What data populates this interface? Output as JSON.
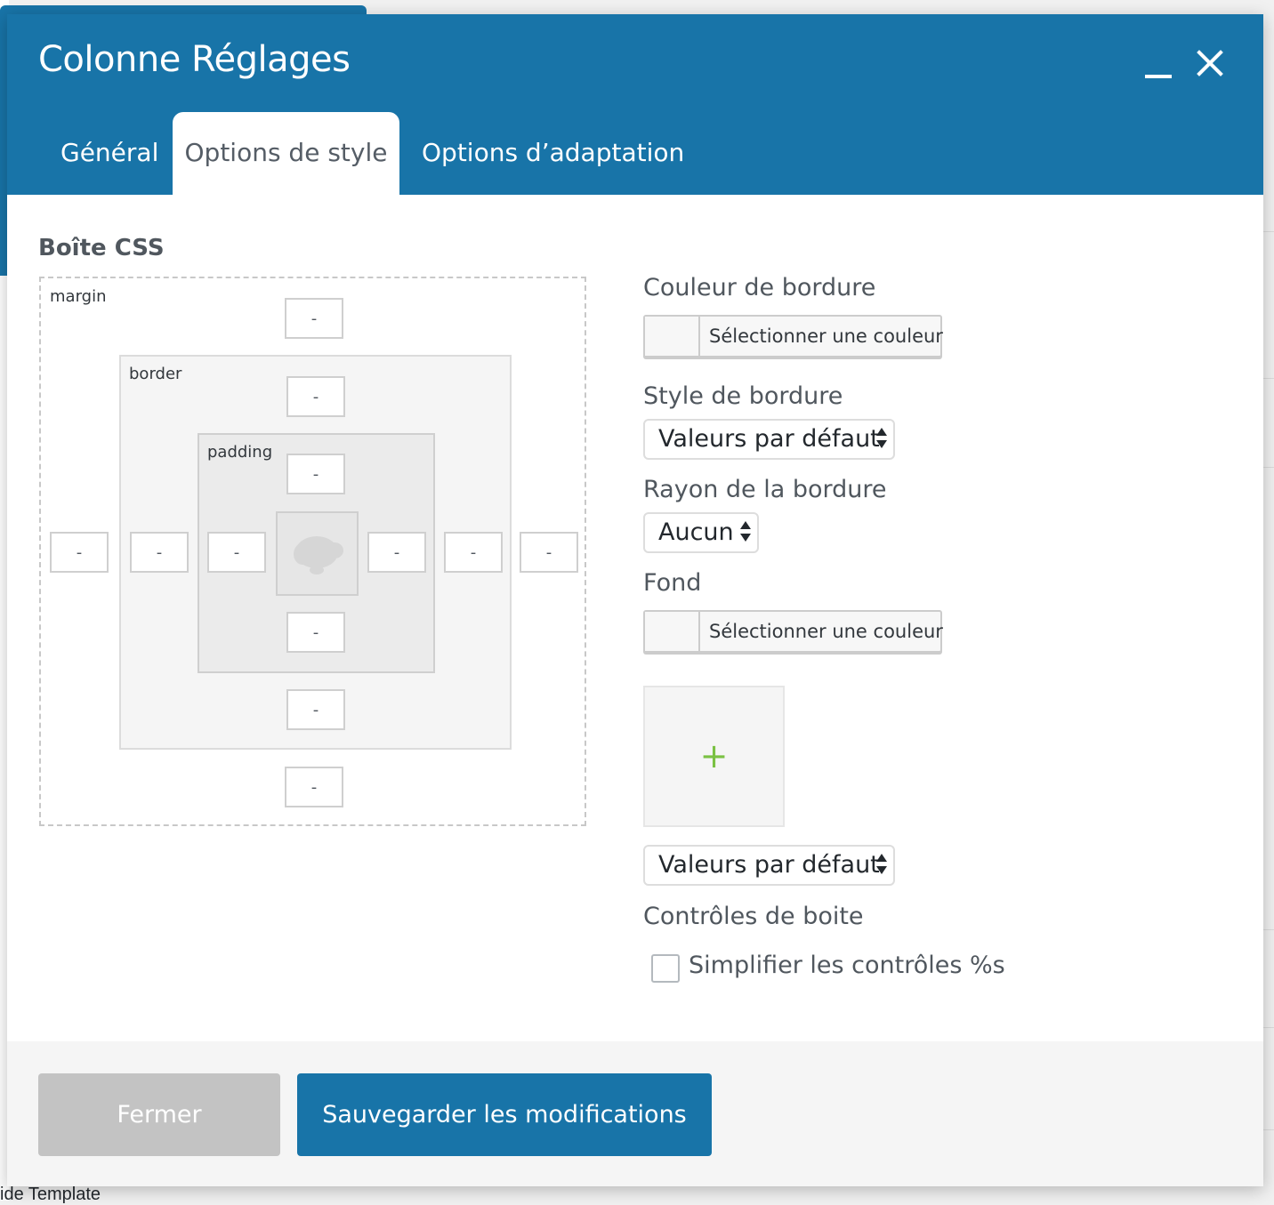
{
  "background": {
    "bottom_text": "ide Template"
  },
  "modal": {
    "title": "Colonne Réglages",
    "tabs": [
      {
        "label": "Général"
      },
      {
        "label": "Options de style"
      },
      {
        "label": "Options d’adaptation"
      }
    ],
    "active_tab": "Options de style"
  },
  "css_box": {
    "title": "Boîte CSS",
    "margin_label": "margin",
    "border_label": "border",
    "padding_label": "padding",
    "margin": {
      "top": "-",
      "right": "-",
      "bottom": "-",
      "left": "-"
    },
    "border": {
      "top": "-",
      "right": "-",
      "bottom": "-",
      "left": "-"
    },
    "padding": {
      "top": "-",
      "right": "-",
      "bottom": "-",
      "left": "-"
    },
    "content_icon": "content-placeholder-icon"
  },
  "fields": {
    "border_color_label": "Couleur de bordure",
    "border_color_button": "Sélectionner une couleur",
    "border_style_label": "Style de bordure",
    "border_style_value": "Valeurs par défaut",
    "border_radius_label": "Rayon de la bordure",
    "border_radius_value": "Aucun",
    "background_label": "Fond",
    "background_color_button": "Sélectionner une couleur",
    "background_image_icon": "+",
    "background_style_value": "Valeurs par défaut",
    "box_controls_label": "Contrôles de boite",
    "simplify_label": "Simplifier les contrôles %s",
    "simplify_checked": false
  },
  "footer": {
    "close_label": "Fermer",
    "save_label": "Sauvegarder les modifications"
  },
  "colors": {
    "primary": "#1874a8",
    "close_button": "#c3c3c3",
    "plus_icon": "#7ac143"
  }
}
